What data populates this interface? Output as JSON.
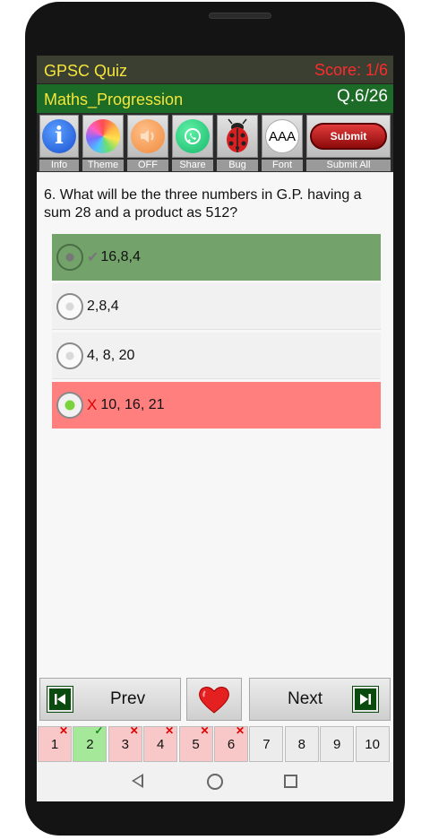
{
  "header": {
    "app_title": "GPSC Quiz",
    "score": "Score: 1/6",
    "topic": "Maths_Progression",
    "question_counter": "Q.6/26"
  },
  "toolbar": {
    "info_label": "Info",
    "theme_label": "Theme",
    "sound_label": "OFF",
    "share_label": "Share",
    "bug_label": "Bug",
    "font_label": "Font",
    "font_icon_text": "AAA",
    "submit_button": "Submit",
    "submit_all_label": "Submit All"
  },
  "question": {
    "text": "6. What will be the three numbers in G.P. having a sum 28 and a product as 512?"
  },
  "options": [
    {
      "text": "16,8,4",
      "state": "correct",
      "mark": "✔"
    },
    {
      "text": "2,8,4",
      "state": "plain"
    },
    {
      "text": "4, 8, 20",
      "state": "plain"
    },
    {
      "text": "10, 16, 21",
      "state": "wrong-selected",
      "mark": "X"
    }
  ],
  "nav": {
    "prev_label": "Prev",
    "next_label": "Next"
  },
  "question_strip": [
    {
      "label": "1",
      "status": "wrong"
    },
    {
      "label": "2",
      "status": "right"
    },
    {
      "label": "3",
      "status": "wrong"
    },
    {
      "label": "4",
      "status": "wrong"
    },
    {
      "label": "5",
      "status": "wrong"
    },
    {
      "label": "6",
      "status": "wrong"
    },
    {
      "label": "7",
      "status": "unanswered"
    },
    {
      "label": "8",
      "status": "unanswered"
    },
    {
      "label": "9",
      "status": "unanswered"
    },
    {
      "label": "10",
      "status": "unanswered"
    }
  ],
  "colors": {
    "title_yellow": "#f5e63a",
    "score_red": "#ff2b2b",
    "topic_bar": "#1c6b26",
    "correct_option": "#73a36a",
    "wrong_option": "#ff7e7e"
  },
  "icons": [
    "info-icon",
    "theme-icon",
    "speaker-icon",
    "share-icon",
    "ladybug-icon",
    "font-icon",
    "prev-icon",
    "heart-icon",
    "next-icon",
    "back-icon",
    "home-icon",
    "recents-icon"
  ]
}
